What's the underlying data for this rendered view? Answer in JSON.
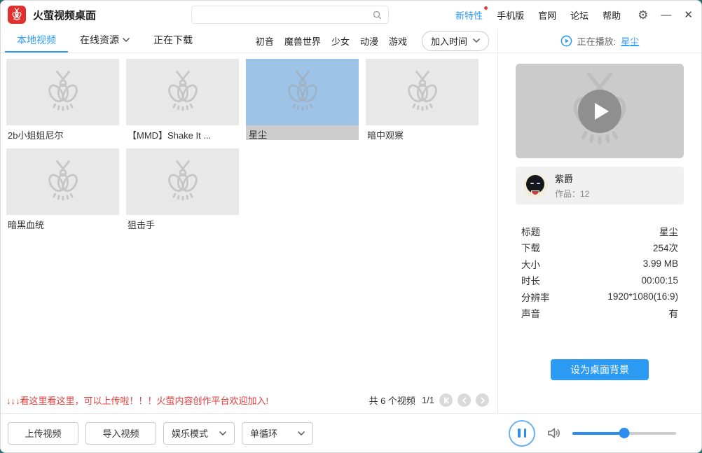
{
  "window": {
    "minimize": "—",
    "close": "✕"
  },
  "app": {
    "title": "火萤视频桌面"
  },
  "titlebar": {
    "menu": [
      {
        "label": "新特性"
      },
      {
        "label": "手机版"
      },
      {
        "label": "官网"
      },
      {
        "label": "论坛"
      },
      {
        "label": "帮助"
      }
    ]
  },
  "search": {
    "value": "",
    "placeholder": ""
  },
  "nav": {
    "tabs": [
      {
        "label": "本地视频"
      },
      {
        "label": "在线资源"
      },
      {
        "label": "正在下载"
      }
    ],
    "categories": [
      "初音",
      "魔兽世界",
      "少女",
      "动漫",
      "游戏"
    ],
    "sort": "加入时间"
  },
  "now_playing": {
    "label": "正在播放:",
    "title": "星尘"
  },
  "videos": [
    {
      "title": "2b小姐姐尼尔"
    },
    {
      "title": "【MMD】Shake It ..."
    },
    {
      "title": "星尘"
    },
    {
      "title": "暗中观察"
    },
    {
      "title": "暗黑血统"
    },
    {
      "title": "狙击手"
    }
  ],
  "artist": {
    "name": "紫爵",
    "works": "作品：12"
  },
  "info": {
    "rows": [
      {
        "label": "标题",
        "value": "星尘"
      },
      {
        "label": "下载",
        "value": "254次"
      },
      {
        "label": "大小",
        "value": "3.99 MB"
      },
      {
        "label": "时长",
        "value": "00:00:15"
      },
      {
        "label": "分辨率",
        "value": "1920*1080(16:9)"
      },
      {
        "label": "声音",
        "value": "有"
      }
    ]
  },
  "wallpaper_button": "设为桌面背景",
  "status": {
    "promo": "↓↓↓看这里看这里，可以上传啦！！！火萤内容创作平台欢迎加入!",
    "count": "共 6 个视频",
    "page": "1/1"
  },
  "toolbar": {
    "upload": "上传视频",
    "import": "导入视频",
    "mode": "娱乐模式",
    "loop": "单循环"
  },
  "player": {
    "volume_percent": 50
  },
  "colors": {
    "accent": "#2d9cf4",
    "selected_thumb": "#9dc3e6",
    "danger": "#e23c3c",
    "brand_red": "#e0312e"
  }
}
